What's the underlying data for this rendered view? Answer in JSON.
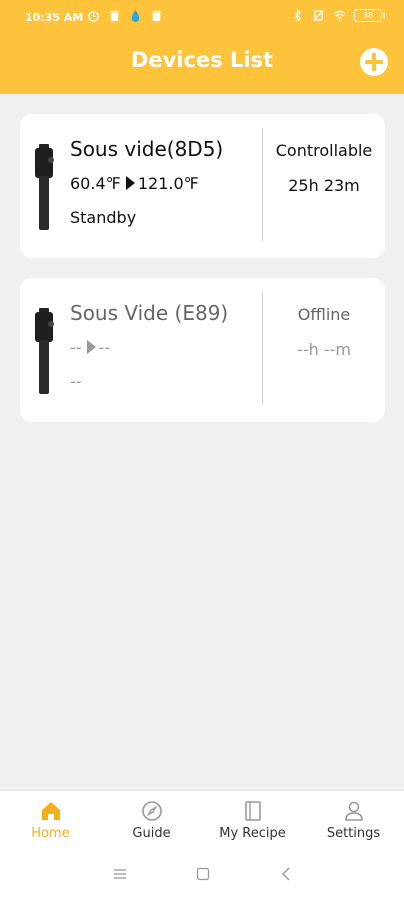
{
  "status_bar": {
    "time": "10:35 AM",
    "battery": "38"
  },
  "header": {
    "title": "Devices List"
  },
  "devices": [
    {
      "name": "Sous vide(8D5)",
      "current_temp": "60.4℉",
      "target_temp": "121.0℉",
      "state": "Standby",
      "status": "Controllable",
      "time": "25h 23m"
    },
    {
      "name": "Sous Vide (E89)",
      "current_temp": "--",
      "target_temp": "--",
      "state": "--",
      "status": "Offline",
      "time": "--h --m"
    }
  ],
  "bottom_nav": {
    "items": [
      {
        "label": "Home"
      },
      {
        "label": "Guide"
      },
      {
        "label": "My Recipe"
      },
      {
        "label": "Settings"
      }
    ]
  },
  "colors": {
    "accent": "#fcc33b",
    "active_nav": "#f2b11b"
  }
}
